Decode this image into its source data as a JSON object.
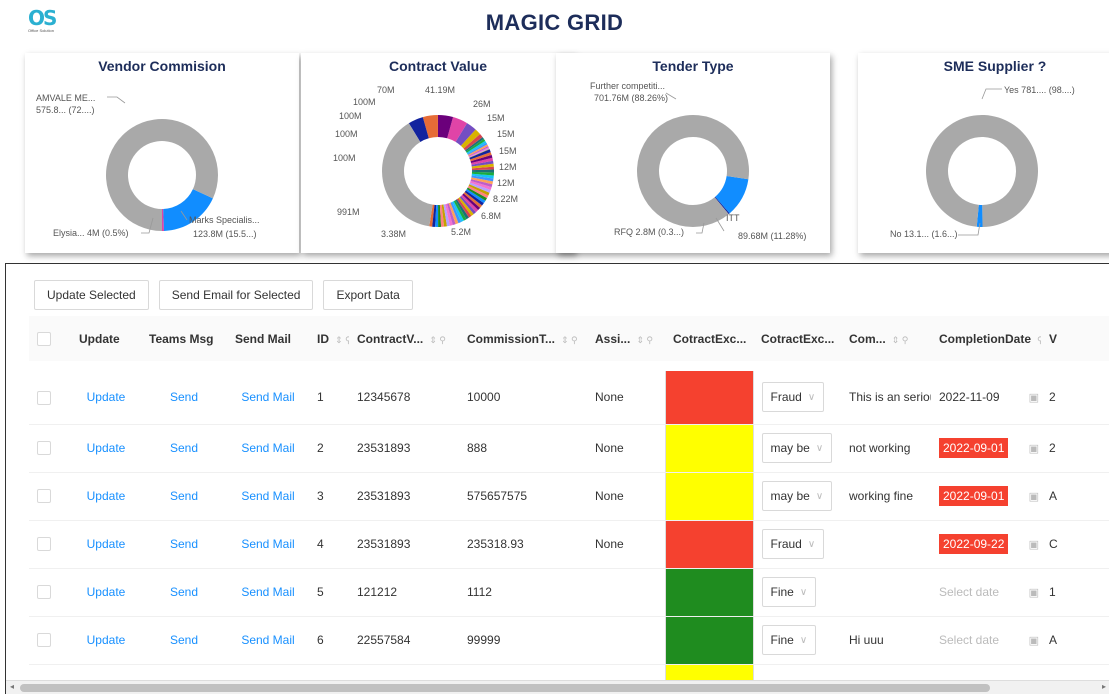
{
  "app": {
    "logo_text": "OS",
    "logo_sub": "Office Solution",
    "title": "MAGIC GRID"
  },
  "charts": {
    "vendor": {
      "title": "Vendor Commision",
      "labels": {
        "top": "AMVALE ME...",
        "top2": "575.8... (72....)",
        "right": "Marks Specialis...",
        "right2": "123.8M (15.5...)",
        "left": "Elysia... 4M (0.5%)"
      }
    },
    "contract": {
      "title": "Contract Value",
      "labels": [
        "70M",
        "41.19M",
        "100M",
        "26M",
        "100M",
        "15M",
        "100M",
        "15M",
        "100M",
        "15M",
        "12M",
        "12M",
        "8.22M",
        "991M",
        "6.8M",
        "3.38M",
        "5.2M"
      ]
    },
    "tender": {
      "title": "Tender Type",
      "labels": {
        "top": "Further competiti...",
        "top2": "701.76M (88.26%)",
        "itt": "ITT",
        "itt2": "89.68M (11.28%)",
        "rfq": "RFQ 2.8M (0.3...)"
      }
    },
    "sme": {
      "title": "SME Supplier ?",
      "labels": {
        "yes": "Yes 781.... (98....)",
        "no": "No 13.1... (1.6...)"
      }
    }
  },
  "chart_data": [
    {
      "type": "pie",
      "title": "Vendor Commision",
      "categories": [
        "AMVALE ME...",
        "Marks Specialis...",
        "Elysia..."
      ],
      "values": [
        575.8,
        123.8,
        4
      ],
      "units": "M",
      "colors": [
        "#a9a9a9",
        "#118dff",
        "#e044a7"
      ]
    },
    {
      "type": "pie",
      "title": "Contract Value",
      "categories": [
        "991M",
        "100M",
        "100M",
        "100M",
        "100M",
        "70M",
        "41.19M",
        "26M",
        "15M",
        "15M",
        "15M",
        "12M",
        "12M",
        "8.22M",
        "6.8M",
        "5.2M",
        "3.38M"
      ],
      "values": [
        991,
        100,
        100,
        100,
        100,
        70,
        41.19,
        26,
        15,
        15,
        15,
        12,
        12,
        8.22,
        6.8,
        5.2,
        3.38
      ],
      "units": "M"
    },
    {
      "type": "pie",
      "title": "Tender Type",
      "categories": [
        "Further competiti...",
        "ITT",
        "RFQ"
      ],
      "values": [
        701.76,
        89.68,
        2.8
      ],
      "units": "M",
      "colors": [
        "#a9a9a9",
        "#118dff",
        "#12239e"
      ]
    },
    {
      "type": "pie",
      "title": "SME Supplier ?",
      "categories": [
        "Yes",
        "No"
      ],
      "values": [
        781,
        13.1
      ],
      "units": "M",
      "colors": [
        "#a9a9a9",
        "#118dff"
      ]
    }
  ],
  "toolbar": {
    "update": "Update Selected",
    "email": "Send Email for Selected",
    "export": "Export Data"
  },
  "columns": [
    "Update",
    "Teams Msg",
    "Send Mail",
    "ID",
    "ContractV...",
    "CommissionT...",
    "Assi...",
    "CotractExc...",
    "CotractExc...",
    "Com...",
    "CompletionDate",
    "V"
  ],
  "rows": [
    {
      "update": "Update",
      "teams": "Send",
      "mail": "Send Mail",
      "id": "1",
      "contract": "12345678",
      "commission": "10000",
      "assigned": "None",
      "color": "#f5412f",
      "status": "Fraud",
      "comment": "This is an seriou",
      "date": "2022-11-09",
      "date_style": "normal",
      "v": "2"
    },
    {
      "update": "Update",
      "teams": "Send",
      "mail": "Send Mail",
      "id": "2",
      "contract": "23531893",
      "commission": "888",
      "assigned": "None",
      "color": "#ffff00",
      "status": "may be",
      "comment": "not working",
      "date": "2022-09-01",
      "date_style": "red",
      "v": "2"
    },
    {
      "update": "Update",
      "teams": "Send",
      "mail": "Send Mail",
      "id": "3",
      "contract": "23531893",
      "commission": "575657575",
      "assigned": "None",
      "color": "#ffff00",
      "status": "may be",
      "comment": "working fine",
      "date": "2022-09-01",
      "date_style": "red",
      "v": "A"
    },
    {
      "update": "Update",
      "teams": "Send",
      "mail": "Send Mail",
      "id": "4",
      "contract": "23531893",
      "commission": "235318.93",
      "assigned": "None",
      "color": "#f5412f",
      "status": "Fraud",
      "comment": "",
      "date": "2022-09-22",
      "date_style": "red",
      "v": "C"
    },
    {
      "update": "Update",
      "teams": "Send",
      "mail": "Send Mail",
      "id": "5",
      "contract": "121212",
      "commission": "1112",
      "assigned": "",
      "color": "#1f8c1f",
      "status": "Fine",
      "comment": "",
      "date": "Select date",
      "date_style": "placeholder",
      "v": "1"
    },
    {
      "update": "Update",
      "teams": "Send",
      "mail": "Send Mail",
      "id": "6",
      "contract": "22557584",
      "commission": "99999",
      "assigned": "",
      "color": "#1f8c1f",
      "status": "Fine",
      "comment": "Hi uuu",
      "date": "Select date",
      "date_style": "placeholder",
      "v": "A"
    },
    {
      "update": "",
      "teams": "",
      "mail": "",
      "id": "",
      "contract": "",
      "commission": "",
      "assigned": "",
      "color": "#ffff00",
      "status": "",
      "comment": "",
      "date": "",
      "date_style": "placeholder",
      "v": ""
    }
  ],
  "icons": {
    "sort": "sort-icon",
    "search": "search-icon",
    "calendar": "calendar-icon",
    "chevron": "chevron-down-icon"
  }
}
